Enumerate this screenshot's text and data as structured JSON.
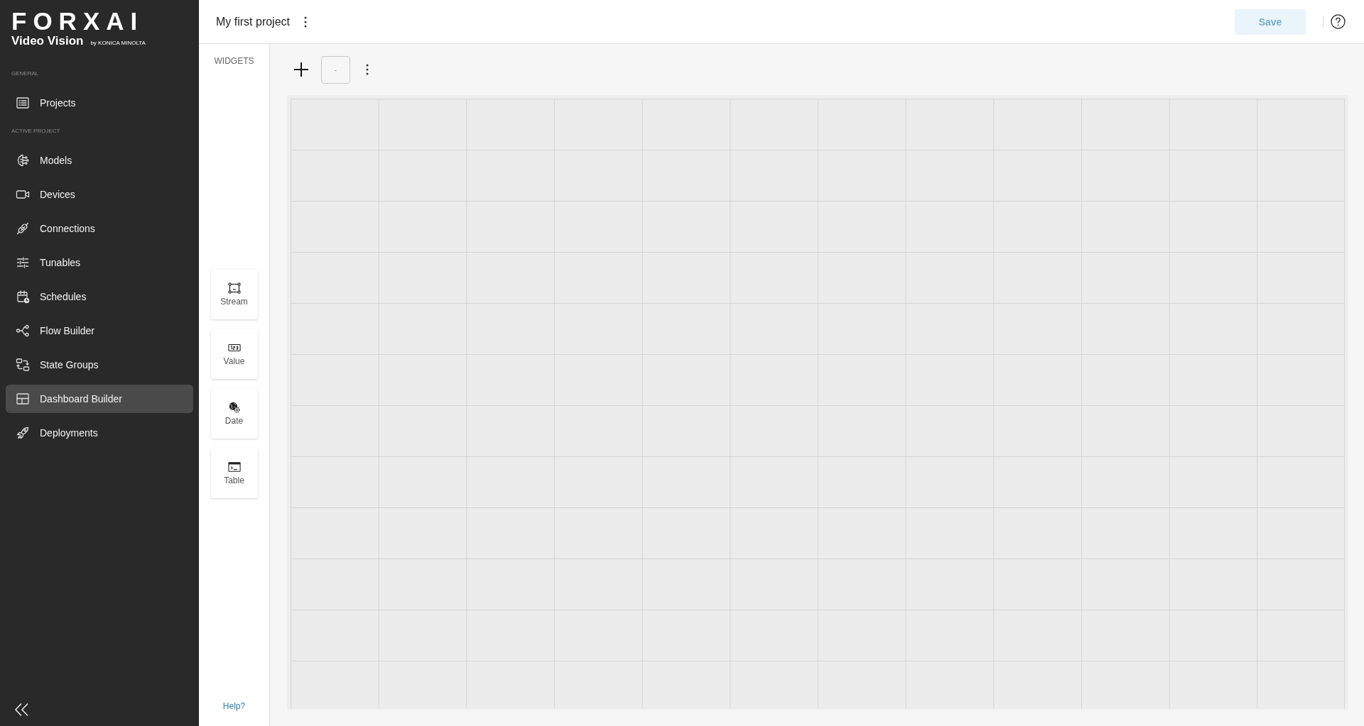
{
  "sidebar": {
    "logo": {
      "brand": "FORXAI",
      "product": "Video Vision",
      "byline": "by KONICA MINOLTA"
    },
    "sections": [
      {
        "heading": "GENERAL",
        "items": [
          {
            "label": "Projects",
            "selected": false
          }
        ]
      },
      {
        "heading": "ACTIVE PROJECT",
        "items": [
          {
            "label": "Models",
            "selected": false
          },
          {
            "label": "Devices",
            "selected": false
          },
          {
            "label": "Connections",
            "selected": false
          },
          {
            "label": "Tunables",
            "selected": false
          },
          {
            "label": "Schedules",
            "selected": false
          },
          {
            "label": "Flow Builder",
            "selected": false
          },
          {
            "label": "State Groups",
            "selected": false
          },
          {
            "label": "Dashboard Builder",
            "selected": true
          },
          {
            "label": "Deployments",
            "selected": false
          }
        ]
      }
    ]
  },
  "header": {
    "title": "My first project",
    "save_button": {
      "label": "Save",
      "disabled": true
    }
  },
  "widgets_panel": {
    "heading": "WIDGETS",
    "widgets": [
      {
        "label": "Stream"
      },
      {
        "label": "Value"
      },
      {
        "label": "Date"
      },
      {
        "label": "Table"
      }
    ],
    "help_link": "Help?"
  },
  "toolbar": {
    "layout_select": {
      "value": "-"
    }
  }
}
